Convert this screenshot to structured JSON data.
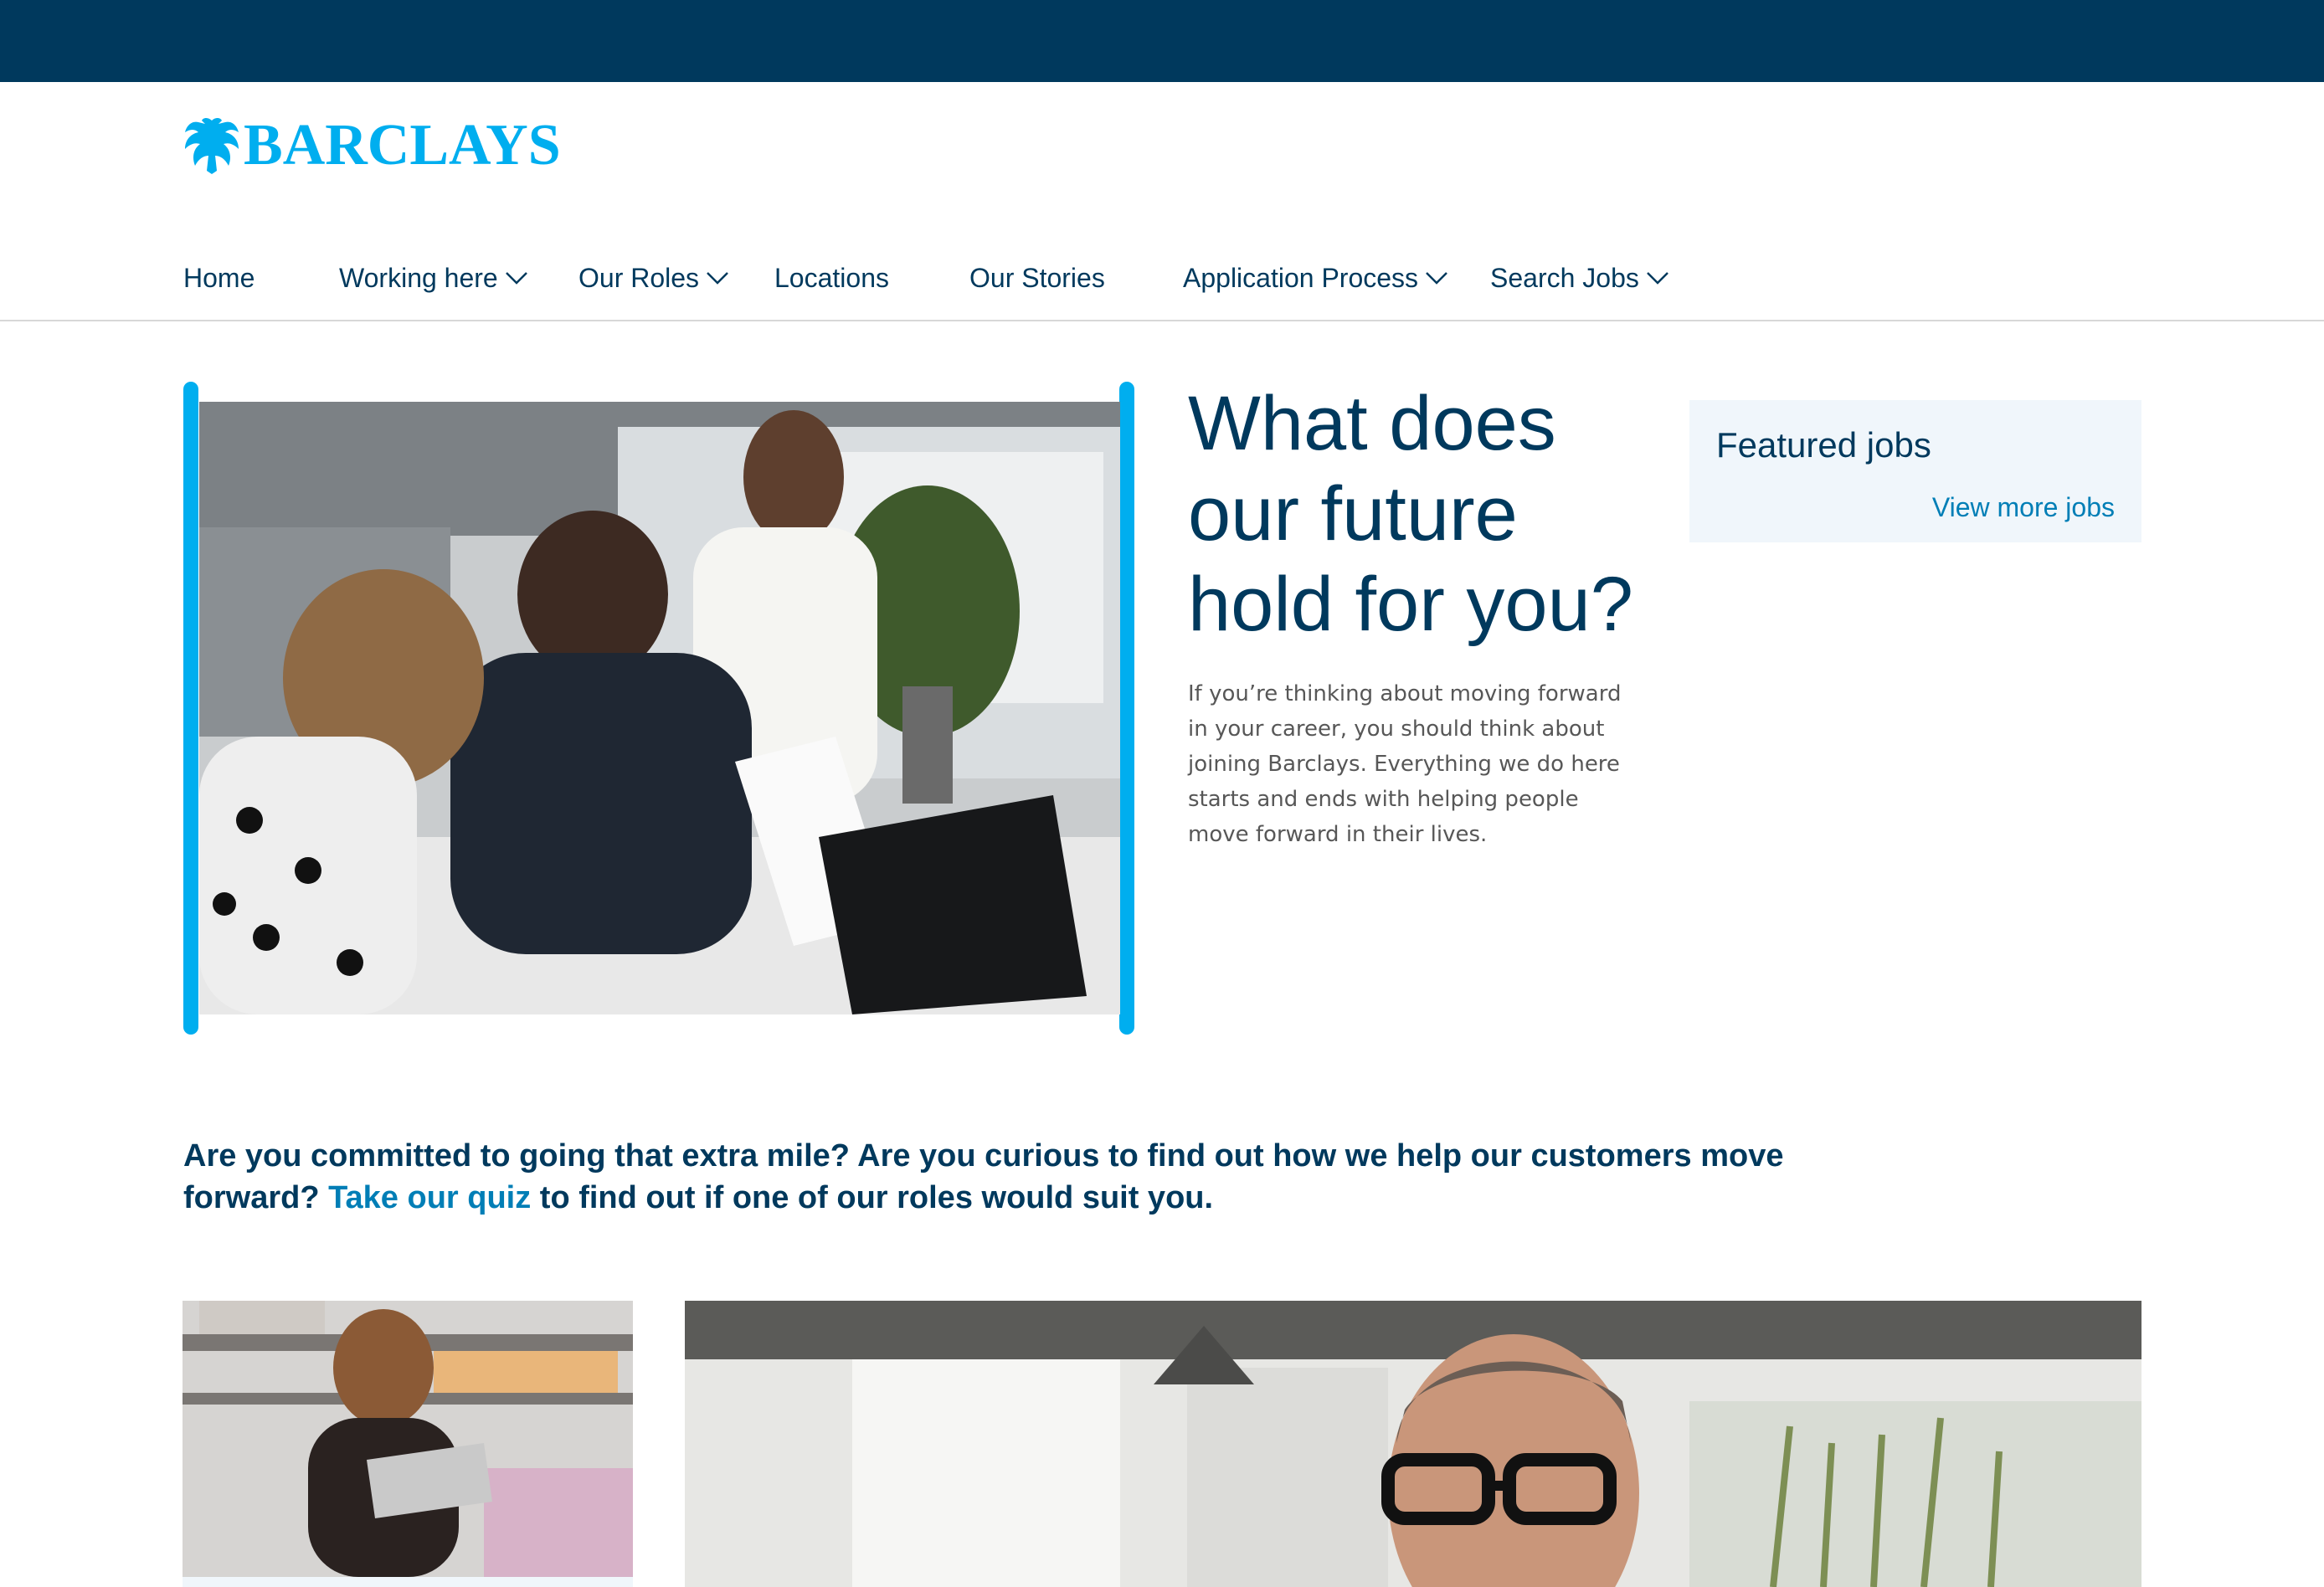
{
  "brand": {
    "name": "BARCLAYS"
  },
  "nav": {
    "items": [
      {
        "label": "Home",
        "dropdown": false
      },
      {
        "label": "Working here",
        "dropdown": true
      },
      {
        "label": "Our Roles",
        "dropdown": true
      },
      {
        "label": "Locations",
        "dropdown": false
      },
      {
        "label": "Our Stories",
        "dropdown": false
      },
      {
        "label": "Application Process",
        "dropdown": true
      },
      {
        "label": "Search Jobs",
        "dropdown": true
      }
    ]
  },
  "hero": {
    "headline": "What does our future hold for you?",
    "intro": "If you’re thinking about moving forward in your career, you should think about joining Barclays. Everything we do here starts and ends with helping people move forward in their lives."
  },
  "featured": {
    "title": "Featured jobs",
    "link": "View more jobs"
  },
  "quiz": {
    "text_before": "Are you committed to going that extra mile? Are you curious to find out how we help our customers move forward? ",
    "link": "Take our quiz",
    "text_after": " to find out if one of our roles would suit you."
  },
  "colors": {
    "header_bar": "#00395d",
    "navy": "#00395d",
    "accent": "#00aeef",
    "link": "#007eb6",
    "featured_bg": "#f0f6fb"
  },
  "icons": {
    "logo": "eagle-icon",
    "dropdown": "chevron-down-icon"
  }
}
